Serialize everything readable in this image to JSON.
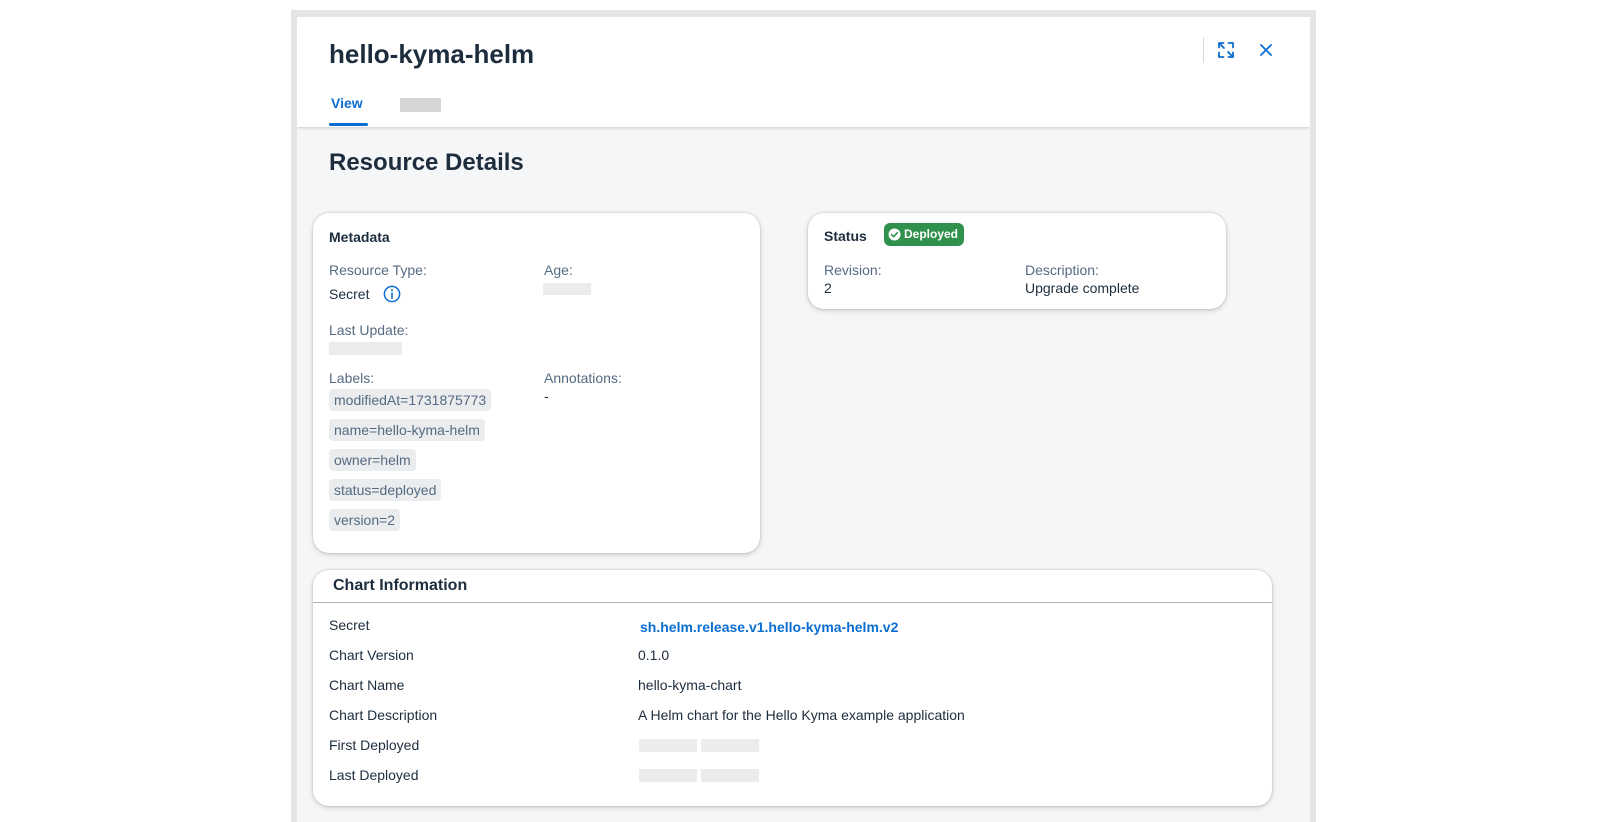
{
  "header": {
    "title": "hello-kyma-helm",
    "tabs": [
      {
        "label": "View",
        "active": true
      }
    ],
    "accent_color": "#0a6ed1"
  },
  "section_title": "Resource Details",
  "metadata": {
    "title": "Metadata",
    "resource_type_label": "Resource Type:",
    "resource_type_value": "Secret",
    "age_label": "Age:",
    "last_update_label": "Last Update:",
    "labels_label": "Labels:",
    "labels": [
      "modifiedAt=1731875773",
      "name=hello-kyma-helm",
      "owner=helm",
      "status=deployed",
      "version=2"
    ],
    "annotations_label": "Annotations:",
    "annotations_value": "-"
  },
  "status": {
    "title": "Status",
    "badge": "Deployed",
    "badge_color": "#30914c",
    "revision_label": "Revision:",
    "revision_value": "2",
    "description_label": "Description:",
    "description_value": "Upgrade complete"
  },
  "chart_info": {
    "title": "Chart Information",
    "secret_label": "Secret",
    "secret_value": "sh.helm.release.v1.hello-kyma-helm.v2",
    "chart_version_label": "Chart Version",
    "chart_version_value": "0.1.0",
    "chart_name_label": "Chart Name",
    "chart_name_value": "hello-kyma-chart",
    "chart_description_label": "Chart Description",
    "chart_description_value": "A Helm chart for the Hello Kyma example application",
    "first_deployed_label": "First Deployed",
    "last_deployed_label": "Last Deployed"
  },
  "icons": [
    "expand-icon",
    "close-icon",
    "info-icon",
    "check-circle-icon"
  ]
}
